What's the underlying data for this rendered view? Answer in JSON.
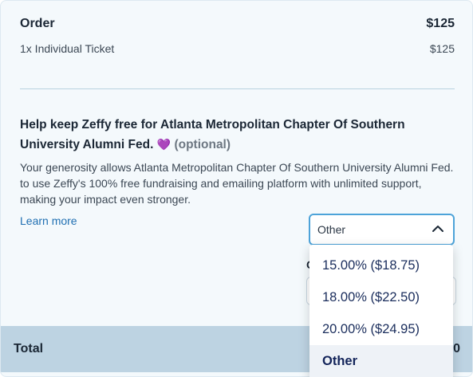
{
  "order": {
    "title": "Order",
    "total_amount": "$125",
    "item_label": "1x Individual Ticket",
    "item_price": "$125"
  },
  "tip": {
    "title": "Help keep Zeffy free for Atlanta Metropolitan Chapter Of Southern University Alumni Fed.",
    "heart": "💜",
    "optional": "(optional)",
    "description": "Your generosity allows Atlanta Metropolitan Chapter Of Southern University Alumni Fed. to use Zeffy's 100% free fundraising and emailing platform with unlimited support, making your impact even stronger.",
    "learn_more": "Learn more",
    "select_value": "Other",
    "custom_label_partial": "C",
    "options": [
      "15.00% ($18.75)",
      "18.00% ($22.50)",
      "20.00% ($24.95)",
      "Other"
    ],
    "selected_option": "Other"
  },
  "total": {
    "label": "Total",
    "value_partial": "00"
  },
  "colors": {
    "accent": "#4da3d9",
    "link": "#1f6fb2",
    "total_bar": "#bdd3e2",
    "heart": "#8a4fd1"
  }
}
